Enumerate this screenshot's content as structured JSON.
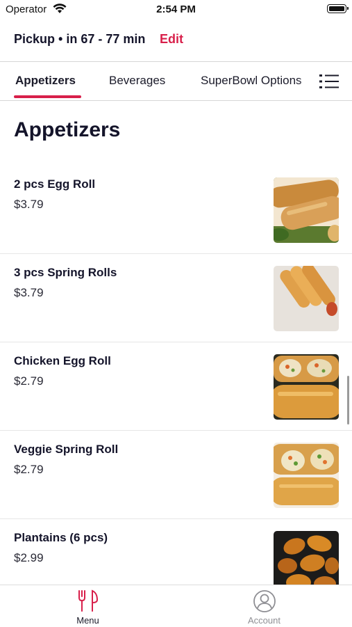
{
  "status_bar": {
    "carrier": "Operator",
    "time": "2:54 PM"
  },
  "header": {
    "pickup_text": "Pickup • in 67 - 77 min",
    "edit_label": "Edit",
    "accent_color": "#d81f4a"
  },
  "tabs": [
    {
      "label": "Appetizers",
      "active": true
    },
    {
      "label": "Beverages",
      "active": false
    },
    {
      "label": "SuperBowl Options",
      "active": false
    }
  ],
  "section": {
    "title": "Appetizers"
  },
  "items": [
    {
      "name": "2 pcs Egg Roll",
      "price": "$3.79",
      "image": "egg-roll-photo"
    },
    {
      "name": "3 pcs Spring Rolls",
      "price": "$3.79",
      "image": "spring-rolls-photo"
    },
    {
      "name": "Chicken Egg Roll",
      "price": "$2.79",
      "image": "chicken-egg-roll-photo"
    },
    {
      "name": "Veggie Spring Roll",
      "price": "$2.79",
      "image": "veggie-spring-roll-photo"
    },
    {
      "name": "Plantains (6 pcs)",
      "price": "$2.99",
      "image": "plantains-photo"
    }
  ],
  "tab_bar": {
    "menu_label": "Menu",
    "menu_icon": "fork-knife-icon",
    "account_label": "Account",
    "account_icon": "user-circle-icon"
  }
}
